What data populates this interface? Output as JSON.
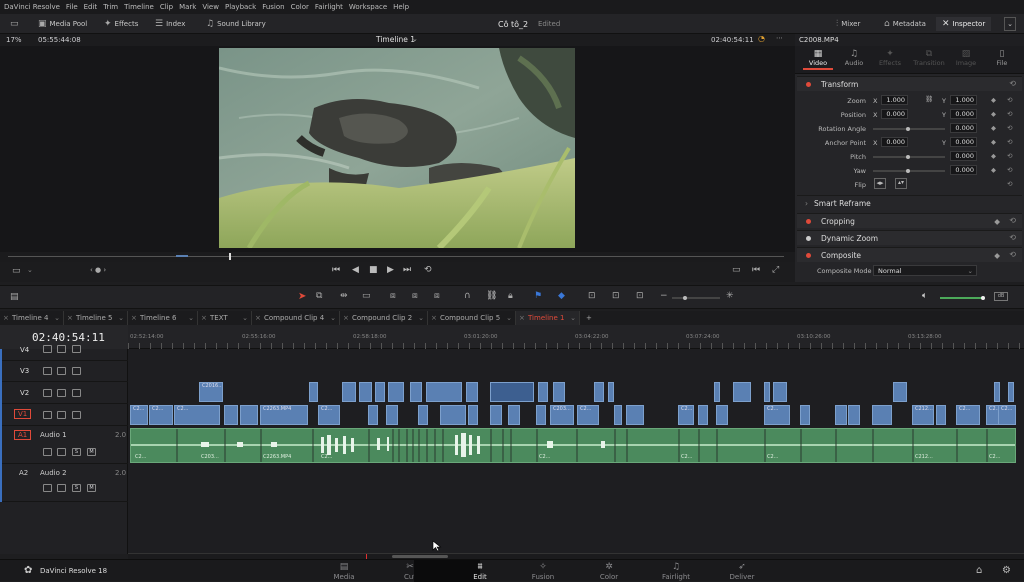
{
  "menu": [
    "DaVinci Resolve",
    "File",
    "Edit",
    "Trim",
    "Timeline",
    "Clip",
    "Mark",
    "View",
    "Playback",
    "Fusion",
    "Color",
    "Fairlight",
    "Workspace",
    "Help"
  ],
  "toolbar": {
    "media_pool": "Media Pool",
    "effects": "Effects",
    "index": "Index",
    "sound_library": "Sound Library",
    "project_name": "Cô tô_2",
    "project_status": "Edited",
    "mixer": "Mixer",
    "metadata": "Metadata",
    "inspector": "Inspector"
  },
  "viewer": {
    "zoom": "17%",
    "source_tc": "05:55:44:08",
    "timeline_name": "Timeline 1",
    "record_tc": "02:40:54:11"
  },
  "inspector": {
    "clip_name": "C2008.MP4",
    "tabs": [
      "Video",
      "Audio",
      "Effects",
      "Transition",
      "Image",
      "File"
    ],
    "transform_title": "Transform",
    "zoom_label": "Zoom",
    "zoom_x": "1.000",
    "zoom_y": "1.000",
    "position_label": "Position",
    "position_x": "0.000",
    "position_y": "0.000",
    "rotation_label": "Rotation Angle",
    "rotation_val": "0.000",
    "anchor_label": "Anchor Point",
    "anchor_x": "0.000",
    "anchor_y": "0.000",
    "pitch_label": "Pitch",
    "pitch_val": "0.000",
    "yaw_label": "Yaw",
    "yaw_val": "0.000",
    "flip_label": "Flip",
    "x": "X",
    "y": "Y",
    "smart_reframe": "Smart Reframe",
    "cropping": "Cropping",
    "dynamic_zoom": "Dynamic Zoom",
    "composite": "Composite",
    "composite_mode_label": "Composite Mode",
    "composite_mode_value": "Normal"
  },
  "timeline_tabs": [
    "Timeline 4",
    "Timeline 5",
    "Timeline 6",
    "TEXT",
    "Compound Clip 4",
    "Compound Clip 2",
    "Compound Clip 5",
    "Timeline 1"
  ],
  "timecode": "02:40:54:11",
  "ruler": [
    "02:52:14:00",
    "02:55:16:00",
    "02:58:18:00",
    "03:01:20:00",
    "03:04:22:00",
    "03:07:24:00",
    "03:10:26:00",
    "03:13:28:00"
  ],
  "tracks": {
    "v4": "V4",
    "v3": "V3",
    "v2": "V2",
    "v1": "V1",
    "a1_id": "A1",
    "a1_name": "Audio 1",
    "a1_ch": "2.0",
    "a2_id": "A2",
    "a2_name": "Audio 2",
    "a2_ch": "2.0",
    "s": "S",
    "m": "M"
  },
  "clip_labels": {
    "c2116": "C2016...",
    "c2263": "C2263.MP4",
    "c20": "C2...",
    "c203": "C203...",
    "c212": "C212...",
    "c2": "C2..."
  },
  "pages": [
    "Media",
    "Cut",
    "Edit",
    "Fusion",
    "Color",
    "Fairlight",
    "Deliver"
  ],
  "app_name": "DaVinci Resolve 18",
  "colors": {
    "accent": "#e04a3a",
    "video_clip": "#5a80b3",
    "audio_clip": "#4b8a5d",
    "playhead": "#e03030"
  }
}
